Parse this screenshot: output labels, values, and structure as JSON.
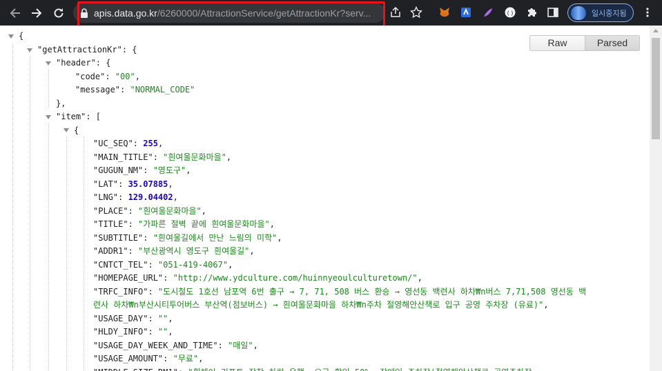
{
  "browser": {
    "url_host": "apis.data.go.kr",
    "url_path": "/6260000/AttractionService/getAttractionKr?serv...",
    "profile_label": "일시중지됨"
  },
  "viewer": {
    "raw_label": "Raw",
    "parsed_label": "Parsed"
  },
  "json_lines": {
    "l0": "{",
    "l1_key": "\"getAttractionKr\"",
    "l1_rest": ": {",
    "l2_key": "\"header\"",
    "l2_rest": ": {",
    "l3_key": "\"code\"",
    "l3_val": "\"00\"",
    "l4_key": "\"message\"",
    "l4_val": "\"NORMAL_CODE\"",
    "l5": "},",
    "l6_key": "\"item\"",
    "l6_rest": ": [",
    "l7": "{",
    "items": [
      {
        "key": "\"UC_SEQ\"",
        "val": "255",
        "type": "n"
      },
      {
        "key": "\"MAIN_TITLE\"",
        "val": "\"흰여울문화마을\"",
        "type": "s"
      },
      {
        "key": "\"GUGUN_NM\"",
        "val": "\"영도구\"",
        "type": "s"
      },
      {
        "key": "\"LAT\"",
        "val": "35.07885",
        "type": "n"
      },
      {
        "key": "\"LNG\"",
        "val": "129.04402",
        "type": "n"
      },
      {
        "key": "\"PLACE\"",
        "val": "\"흰여울문화마을\"",
        "type": "s"
      },
      {
        "key": "\"TITLE\"",
        "val": "\"가파른 절벽 끝에 흰여울문화마을\"",
        "type": "s"
      },
      {
        "key": "\"SUBTITLE\"",
        "val": "\"흰여울길에서 만난 느림의 미학\"",
        "type": "s"
      },
      {
        "key": "\"ADDR1\"",
        "val": "\"부산광역시 영도구 흰여울길\"",
        "type": "s"
      },
      {
        "key": "\"CNTCT_TEL\"",
        "val": "\"051-419-4067\"",
        "type": "s"
      },
      {
        "key": "\"HOMEPAGE_URL\"",
        "val": "\"http://www.ydculture.com/huinnyeoulculturetown/\"",
        "type": "s"
      },
      {
        "key": "\"TRFC_INFO\"",
        "val": "\"도시철도 1호선 남포역 6번 출구 → 7, 71, 508 버스 환승 → 영선동 백련사 하차₩n버스 7,71,508 영선동 백",
        "type": "s"
      },
      {
        "key": "",
        "val": "련사 하차₩n부산시티투어버스 부산역(점보버스) → 흰여울문화마을 하차₩n주차 절영해안산책로 입구 공영 주차장 (유료)\"",
        "type": "s"
      },
      {
        "key": "\"USAGE_DAY\"",
        "val": "\"\"",
        "type": "s"
      },
      {
        "key": "\"HLDY_INFO\"",
        "val": "\"\"",
        "type": "s"
      },
      {
        "key": "\"USAGE_DAY_WEEK_AND_TIME\"",
        "val": "\"매일\"",
        "type": "s"
      },
      {
        "key": "\"USAGE_AMOUNT\"",
        "val": "\"무료\"",
        "type": "s"
      },
      {
        "key": "\"MIDDLE_SIZE_RM1\"",
        "val": "\"휠체어 리프트 장착 차량 운행, 요금 할인 50%, 장애인 주차장(절영해안산책로 공영주차장",
        "type": "s"
      }
    ]
  }
}
